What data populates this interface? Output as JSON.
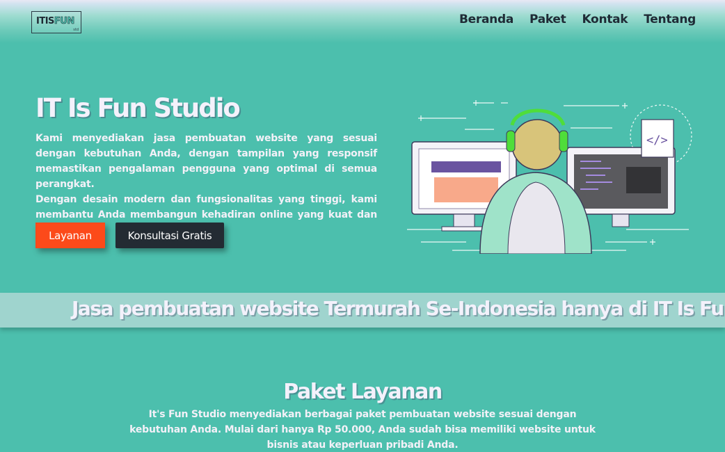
{
  "header": {
    "logo": {
      "itis": "ITIS",
      "fun": "FUN",
      "sub": "std"
    },
    "nav": [
      "Beranda",
      "Paket",
      "Kontak",
      "Tentang"
    ]
  },
  "hero": {
    "title": "IT Is Fun Studio",
    "paragraph_1": "Kami menyediakan jasa pembuatan website yang sesuai dengan kebutuhan Anda, dengan tampilan yang responsif memastikan pengalaman pengguna yang optimal di semua perangkat.",
    "paragraph_2": "Dengan desain modern dan fungsionalitas yang tinggi, kami membantu Anda membangun kehadiran online yang kuat dan menarik.",
    "primary_button": "Layanan",
    "secondary_button": "Konsultasi Gratis",
    "illustration_code_tag": "</>"
  },
  "marquee": {
    "text": "Jasa pembuatan website Termurah Se-Indonesia hanya di IT Is Fun Studio"
  },
  "services": {
    "title": "Paket Layanan",
    "description": "It's Fun Studio menyediakan berbagai paket pembuatan website sesuai dengan kebutuhan Anda. Mulai dari hanya Rp 50.000, Anda sudah bisa memiliki website untuk bisnis atau keperluan pribadi Anda."
  },
  "colors": {
    "background": "#4cbfad",
    "primary_button": "#fc4a1a",
    "secondary_button": "#232b33",
    "marquee_band": "#9fd4ce",
    "heading_text": "#f3f1fb",
    "nav_text": "#1f2b36"
  }
}
